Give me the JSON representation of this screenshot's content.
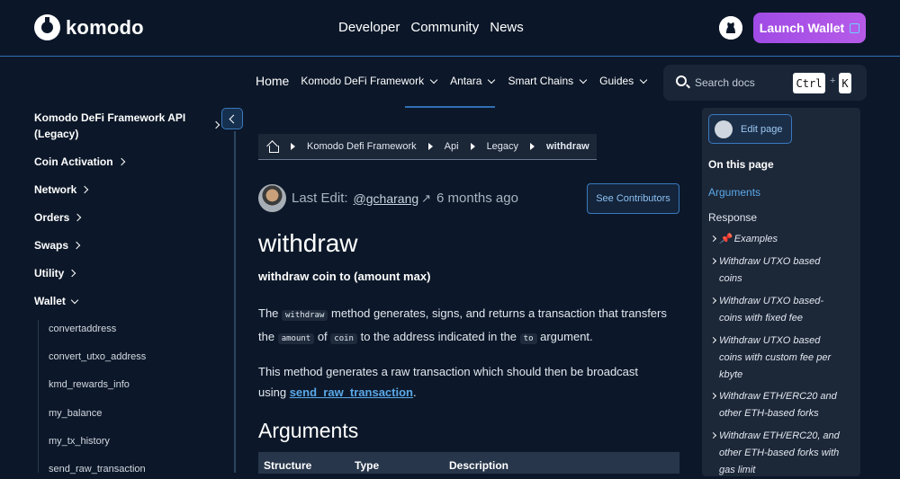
{
  "header": {
    "logo_text": "komodo",
    "nav": [
      "Developer",
      "Community",
      "News"
    ],
    "launch_label": "Launch Wallet"
  },
  "subnav": {
    "home": "Home",
    "items": [
      "Komodo DeFi Framework",
      "Antara",
      "Smart Chains",
      "Guides"
    ]
  },
  "search": {
    "placeholder": "Search docs",
    "key1": "Ctrl",
    "plus": "+",
    "key2": "K"
  },
  "sidebar": {
    "title_line1": "Komodo DeFi Framework API",
    "title_line2": "(Legacy)",
    "sections": [
      "Coin Activation",
      "Network",
      "Orders",
      "Swaps",
      "Utility",
      "Wallet"
    ],
    "wallet_items": [
      "convertaddress",
      "convert_utxo_address",
      "kmd_rewards_info",
      "my_balance",
      "my_tx_history",
      "send_raw_transaction"
    ]
  },
  "breadcrumb": [
    "Komodo Defi Framework",
    "Api",
    "Legacy",
    "withdraw"
  ],
  "meta": {
    "last_edit_label": "Last Edit:",
    "author": "@gcharang",
    "author_arrow": "↗",
    "time_ago": "6 months ago",
    "contributors_label": "See Contributors"
  },
  "content": {
    "title": "withdraw",
    "subtitle": "withdraw coin to (amount max)",
    "p1_a": "The ",
    "p1_code1": "withdraw",
    "p1_b": " method generates, signs, and returns a transaction that transfers the ",
    "p1_code2": "amount",
    "p1_c": " of ",
    "p1_code3": "coin",
    "p1_d": " to the address indicated in the ",
    "p1_code4": "to",
    "p1_e": " argument.",
    "p2_a": "This method generates a raw transaction which should then be broadcast using ",
    "p2_link": "send_raw_transaction",
    "p2_b": ".",
    "h2": "Arguments",
    "table_headers": [
      "Structure",
      "Type",
      "Description"
    ]
  },
  "toc": {
    "edit_label": "Edit page",
    "title": "On this page",
    "items": [
      "Arguments",
      "Response"
    ],
    "subitems": [
      "📌 Examples",
      "Withdraw UTXO based coins",
      "Withdraw UTXO based-coins with fixed fee",
      "Withdraw UTXO based coins with custom fee per kbyte",
      "Withdraw ETH/ERC20 and other ETH-based forks",
      "Withdraw ETH/ERC20, and other ETH-based forks with gas limit"
    ]
  },
  "colors": {
    "background": "#0c1829",
    "accent": "#2f6fb3",
    "link": "#5aa8e8",
    "launch": "#a04be6"
  }
}
